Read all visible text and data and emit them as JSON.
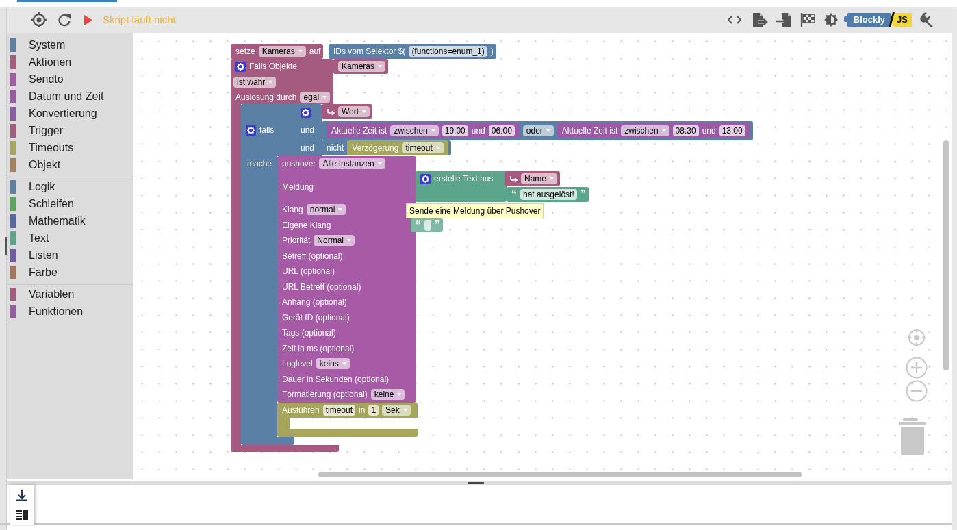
{
  "toolbar": {
    "running": false,
    "status": "Skript läuft nicht",
    "logo": [
      "Blockly",
      "JS"
    ]
  },
  "categories": [
    {
      "items": [
        {
          "label": "System",
          "color": "#5b80a5"
        },
        {
          "label": "Aktionen",
          "color": "#a55b80"
        },
        {
          "label": "Sendto",
          "color": "#a55ba5"
        },
        {
          "label": "Datum und Zeit",
          "color": "#995ba5"
        },
        {
          "label": "Konvertierung",
          "color": "#8a5ba5"
        },
        {
          "label": "Trigger",
          "color": "#a55b80"
        },
        {
          "label": "Timeouts",
          "color": "#a5a55b"
        },
        {
          "label": "Objekt",
          "color": "#a5805b"
        }
      ]
    },
    {
      "items": [
        {
          "label": "Logik",
          "color": "#5b80a5"
        },
        {
          "label": "Schleifen",
          "color": "#5ba55b"
        },
        {
          "label": "Mathematik",
          "color": "#5b67a5"
        },
        {
          "label": "Text",
          "color": "#5ba58c"
        },
        {
          "label": "Listen",
          "color": "#745ba5"
        },
        {
          "label": "Farbe",
          "color": "#a5745b"
        }
      ]
    },
    {
      "items": [
        {
          "label": "Variablen",
          "color": "#a55b80"
        },
        {
          "label": "Funktionen",
          "color": "#995ba5"
        }
      ]
    }
  ],
  "workspace": {
    "blocks": [
      {
        "color": "#a55b80",
        "rows": [
          {
            "left": [
              {
                "kind": "label",
                "text": "setze"
              },
              {
                "kind": "dropdown",
                "text": "Kameras"
              },
              {
                "kind": "label",
                "text": "auf"
              }
            ]
          }
        ]
      },
      {
        "color": "#5b80a5",
        "rows": [
          {
            "left": [
              {
                "kind": "label",
                "text": "IDs vom Selektor $("
              },
              {
                "kind": "field",
                "text": "(functions=enum_1)"
              },
              {
                "kind": "label",
                "text": ")"
              }
            ]
          }
        ]
      },
      {
        "color": "#a55b80",
        "rows": [
          {
            "left": [
              {
                "kind": "gear"
              },
              {
                "kind": "label",
                "text": "Falls Objekte"
              }
            ]
          },
          {
            "left": [
              {
                "kind": "dropdown",
                "text": "ist wahr"
              }
            ]
          },
          {
            "left": [
              {
                "kind": "label",
                "text": "Auslösung durch"
              },
              {
                "kind": "dropdown",
                "text": "egal"
              }
            ]
          }
        ]
      },
      {
        "color": "#a55b80",
        "rows": [
          {
            "left": [
              {
                "kind": "dropdown",
                "text": "Kameras"
              }
            ]
          }
        ]
      },
      {
        "color": "#5b80a5",
        "rows": [
          {
            "right": [
              {
                "kind": "gear"
              }
            ]
          },
          {
            "left": [
              {
                "kind": "gear"
              },
              {
                "kind": "label",
                "text": "falls"
              }
            ],
            "right": [
              {
                "kind": "label",
                "text": "und"
              }
            ]
          },
          {
            "right": [
              {
                "kind": "label",
                "text": "und"
              }
            ]
          },
          {
            "left": [
              {
                "kind": "label",
                "text": "mache"
              }
            ]
          }
        ]
      },
      {
        "color": "#a55b80",
        "rows": [
          {
            "left": [
              {
                "kind": "arrow"
              },
              {
                "kind": "dropdown",
                "text": "Wert"
              }
            ]
          }
        ]
      },
      {
        "color": "#5b80a5",
        "rows": [
          {
            "left": [
              {
                "kind": "block",
                "color": "#995ba5",
                "parts": [
                  {
                    "kind": "label",
                    "text": "Aktuelle Zeit ist"
                  },
                  {
                    "kind": "dropdown",
                    "text": "zwischen"
                  },
                  {
                    "kind": "field",
                    "text": "19:00"
                  },
                  {
                    "kind": "label",
                    "text": "und"
                  },
                  {
                    "kind": "field",
                    "text": "06:00"
                  }
                ]
              },
              {
                "kind": "dropdown",
                "text": "oder"
              },
              {
                "kind": "block",
                "color": "#995ba5",
                "parts": [
                  {
                    "kind": "label",
                    "text": "Aktuelle Zeit ist"
                  },
                  {
                    "kind": "dropdown",
                    "text": "zwischen"
                  },
                  {
                    "kind": "field",
                    "text": "08:30"
                  },
                  {
                    "kind": "label",
                    "text": "und"
                  },
                  {
                    "kind": "field",
                    "text": "13:00"
                  }
                ]
              }
            ]
          }
        ]
      },
      {
        "color": "#5b80a5",
        "rows": [
          {
            "left": [
              {
                "kind": "label",
                "text": "nicht"
              },
              {
                "kind": "block",
                "color": "#a5a55b",
                "parts": [
                  {
                    "kind": "label",
                    "text": "Verzögerung"
                  },
                  {
                    "kind": "dropdown",
                    "text": "timeout"
                  }
                ]
              }
            ]
          }
        ]
      },
      {
        "color": "#a55ba5",
        "rows": [
          {
            "left": [
              {
                "kind": "label",
                "text": "pushover"
              },
              {
                "kind": "dropdown",
                "text": "Alle Instanzen"
              }
            ]
          },
          {
            "left": [
              {
                "kind": "label",
                "text": "Meldung"
              }
            ]
          },
          {
            "left": [
              {
                "kind": "label",
                "text": "Klang"
              },
              {
                "kind": "dropdown",
                "text": "normal"
              }
            ]
          },
          {
            "left": [
              {
                "kind": "label",
                "text": "Eigene Klang"
              }
            ]
          },
          {
            "left": [
              {
                "kind": "label",
                "text": "Priorität"
              },
              {
                "kind": "dropdown",
                "text": "Normal"
              }
            ]
          },
          {
            "left": [
              {
                "kind": "label",
                "text": "Betreff (optional)"
              }
            ]
          },
          {
            "left": [
              {
                "kind": "label",
                "text": "URL (optional)"
              }
            ]
          },
          {
            "left": [
              {
                "kind": "label",
                "text": "URL Betreff (optional)"
              }
            ]
          },
          {
            "left": [
              {
                "kind": "label",
                "text": "Anhang (optional)"
              }
            ]
          },
          {
            "left": [
              {
                "kind": "label",
                "text": "Gerät ID (optional)"
              }
            ]
          },
          {
            "left": [
              {
                "kind": "label",
                "text": "Tags (optional)"
              }
            ]
          },
          {
            "left": [
              {
                "kind": "label",
                "text": "Zeit in ms (optional)"
              }
            ]
          },
          {
            "left": [
              {
                "kind": "label",
                "text": "Loglevel"
              },
              {
                "kind": "dropdown",
                "text": "keins"
              }
            ]
          },
          {
            "left": [
              {
                "kind": "label",
                "text": "Dauer in Sekunden (optional)"
              }
            ]
          },
          {
            "left": [
              {
                "kind": "label",
                "text": "Formatierung (optional)"
              },
              {
                "kind": "dropdown",
                "text": "keine"
              }
            ]
          }
        ]
      },
      {
        "color": "#5ba58c",
        "rows": [
          {
            "left": [
              {
                "kind": "gear"
              },
              {
                "kind": "label",
                "text": "erstelle Text aus"
              }
            ]
          }
        ]
      },
      {
        "color": "#a55b80",
        "rows": [
          {
            "left": [
              {
                "kind": "arrow"
              },
              {
                "kind": "dropdown",
                "text": "Name"
              }
            ]
          }
        ]
      },
      {
        "color": "#5ba58c",
        "rows": [
          {
            "left": [
              {
                "kind": "quote",
                "text": "“"
              },
              {
                "kind": "field",
                "text": "hat ausgelöst!"
              },
              {
                "kind": "quote",
                "text": "”"
              }
            ]
          }
        ]
      },
      {
        "color": "#7fb9a5",
        "rows": [
          {
            "left": [
              {
                "kind": "quote",
                "text": "“"
              },
              {
                "kind": "field"
              },
              {
                "kind": "quote",
                "text": "”"
              }
            ]
          }
        ]
      },
      {
        "color": "#a5a55b",
        "rows": [
          {
            "left": [
              {
                "kind": "label",
                "text": "Ausführen"
              },
              {
                "kind": "field",
                "text": "timeout"
              },
              {
                "kind": "label",
                "text": "in"
              },
              {
                "kind": "field",
                "text": "1"
              },
              {
                "kind": "dropdown",
                "text": "Sek"
              }
            ]
          }
        ]
      }
    ],
    "tooltip": "Sende eine Meldung über Pushover"
  }
}
